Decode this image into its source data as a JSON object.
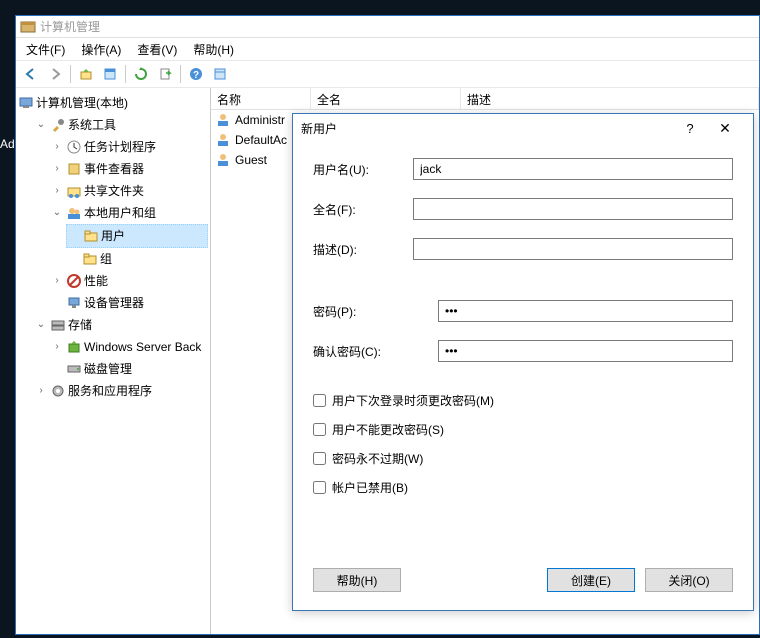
{
  "partial": "Ad",
  "window": {
    "title": "计算机管理"
  },
  "menu": {
    "file": "文件(F)",
    "action": "操作(A)",
    "view": "查看(V)",
    "help": "帮助(H)"
  },
  "tree": {
    "root": "计算机管理(本地)",
    "system_tools": "系统工具",
    "task_scheduler": "任务计划程序",
    "event_viewer": "事件查看器",
    "shared_folders": "共享文件夹",
    "local_users_groups": "本地用户和组",
    "users": "用户",
    "groups": "组",
    "performance": "性能",
    "device_manager": "设备管理器",
    "storage": "存储",
    "windows_server_backup": "Windows Server Back",
    "disk_management": "磁盘管理",
    "services_apps": "服务和应用程序"
  },
  "list": {
    "columns": {
      "name": "名称",
      "fullname": "全名",
      "description": "描述"
    },
    "rows": [
      {
        "name": "Administr"
      },
      {
        "name": "DefaultAc"
      },
      {
        "name": "Guest"
      }
    ]
  },
  "dialog": {
    "title": "新用户",
    "labels": {
      "username": "用户名(U):",
      "fullname": "全名(F):",
      "description": "描述(D):",
      "password": "密码(P):",
      "confirm": "确认密码(C):"
    },
    "values": {
      "username": "jack",
      "fullname": "",
      "description": "",
      "password": "•••",
      "confirm": "•••"
    },
    "checkboxes": {
      "must_change": "用户下次登录时须更改密码(M)",
      "cannot_change": "用户不能更改密码(S)",
      "never_expires": "密码永不过期(W)",
      "disabled": "帐户已禁用(B)"
    },
    "buttons": {
      "help": "帮助(H)",
      "create": "创建(E)",
      "close": "关闭(O)"
    }
  }
}
